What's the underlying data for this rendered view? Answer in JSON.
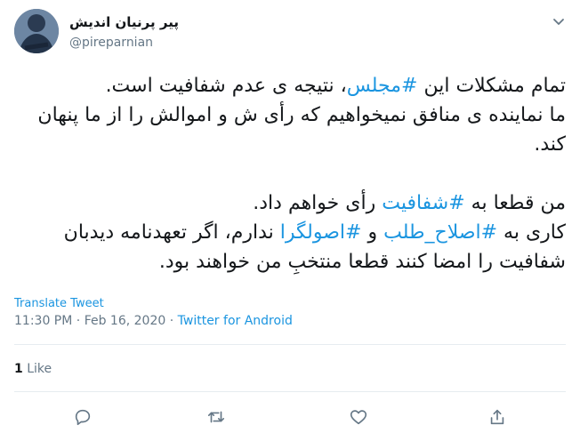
{
  "user": {
    "display_name": "پیر پرنیان اندیش",
    "handle": "@pireparnian",
    "avatar_icon": "avatar-image"
  },
  "tweet": {
    "p1_pre": "تمام مشکلات این ",
    "p1_tag": "#مجلس",
    "p1_post": "، نتیجه ی عدم شفافیت است.\nما نماینده ی منافق نمیخواهیم که رأی ش و اموالش را از ما پنهان کند.\n\n",
    "p2_pre": "من قطعا به ",
    "p2_tag": "#شفافیت",
    "p2_post": " رأی خواهم داد.\nکاری به ",
    "p3_tag1": "#اصلاح_طلب",
    "p3_mid": " و ",
    "p3_tag2": "#اصولگرا",
    "p3_post": " ندارم، اگر تعهدنامه دیدبان شفافیت را امضا کنند قطعا منتخبِ من خواهند بود."
  },
  "translate_label": "Translate Tweet",
  "meta": {
    "time": "11:30 PM",
    "sep1": " · ",
    "date": "Feb 16, 2020",
    "sep2": " · ",
    "source": "Twitter for Android"
  },
  "stats": {
    "likes_count": "1",
    "likes_label": "Like"
  },
  "actions": [
    "reply-icon",
    "retweet-icon",
    "like-icon",
    "share-icon"
  ],
  "colors": {
    "link": "#1b95e0",
    "muted": "#657786",
    "text": "#14171a",
    "divider": "#e6ecf0"
  }
}
